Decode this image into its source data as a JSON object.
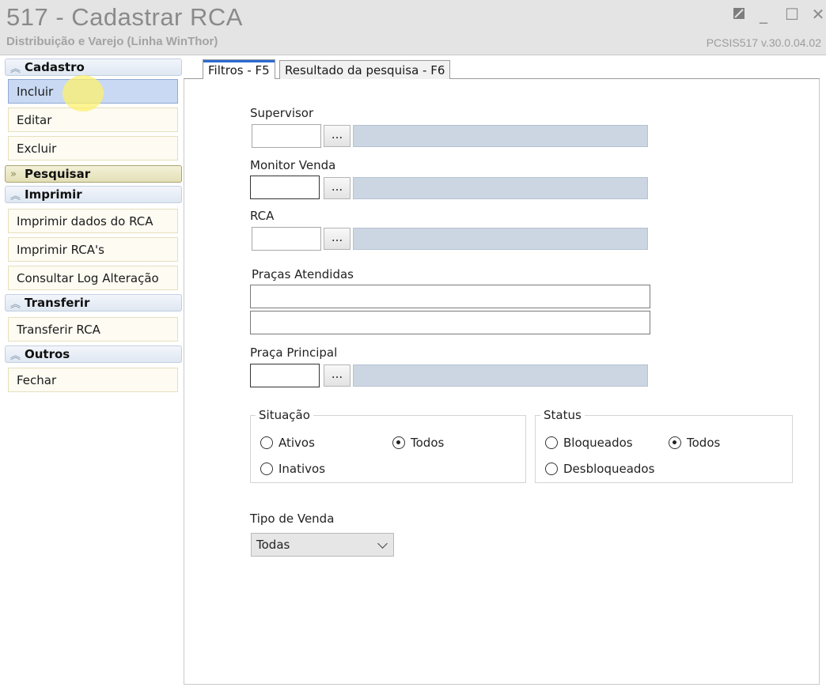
{
  "window": {
    "title": "517 - Cadastrar RCA",
    "subtitle": "Distribuição e Varejo (Linha WinThor)",
    "version": "PCSIS517  v.30.0.04.02",
    "controls": {
      "restore_icon": "restore-icon",
      "minimize_glyph": "_",
      "maximize_glyph": "☐",
      "close_glyph": "✕"
    }
  },
  "sidebar": {
    "groups": [
      {
        "title": "Cadastro",
        "state": "expanded",
        "items": [
          "Incluir",
          "Editar",
          "Excluir"
        ]
      },
      {
        "title": "Pesquisar",
        "state": "collapsed",
        "items": []
      },
      {
        "title": "Imprimir",
        "state": "expanded",
        "items": [
          "Imprimir dados do RCA",
          "Imprimir RCA's",
          "Consultar Log Alteração"
        ]
      },
      {
        "title": "Transferir",
        "state": "expanded",
        "items": [
          "Transferir RCA"
        ]
      },
      {
        "title": "Outros",
        "state": "expanded",
        "items": [
          "Fechar"
        ]
      }
    ],
    "expanded_glyph": "≫",
    "collapsed_glyph": "»"
  },
  "tabs": [
    {
      "label": "Filtros - F5",
      "selected": true
    },
    {
      "label": "Resultado da pesquisa - F6",
      "selected": false
    }
  ],
  "filters": {
    "supervisor": {
      "label": "Supervisor",
      "code": "",
      "description": ""
    },
    "monitor_venda": {
      "label": "Monitor Venda",
      "code": "",
      "description": ""
    },
    "rca": {
      "label": "RCA",
      "code": "",
      "description": ""
    },
    "pracas_atendidas": {
      "label": "Praças Atendidas",
      "line1": "",
      "line2": ""
    },
    "praca_principal": {
      "label": "Praça Principal",
      "code": "",
      "description": ""
    },
    "lookup_button": "...",
    "situacao": {
      "title": "Situação",
      "options": [
        {
          "label": "Ativos",
          "checked": false
        },
        {
          "label": "Todos",
          "checked": true
        },
        {
          "label": "Inativos",
          "checked": false
        }
      ]
    },
    "status": {
      "title": "Status",
      "options": [
        {
          "label": "Bloqueados",
          "checked": false
        },
        {
          "label": "Todos",
          "checked": true
        },
        {
          "label": "Desbloqueados",
          "checked": false
        }
      ]
    },
    "tipo_venda": {
      "label": "Tipo de Venda",
      "selected": "Todas"
    }
  },
  "colors": {
    "active_item": "#c9d9f3",
    "description_field": "#ccd6e3",
    "tab_accent": "#2d6bd1"
  }
}
